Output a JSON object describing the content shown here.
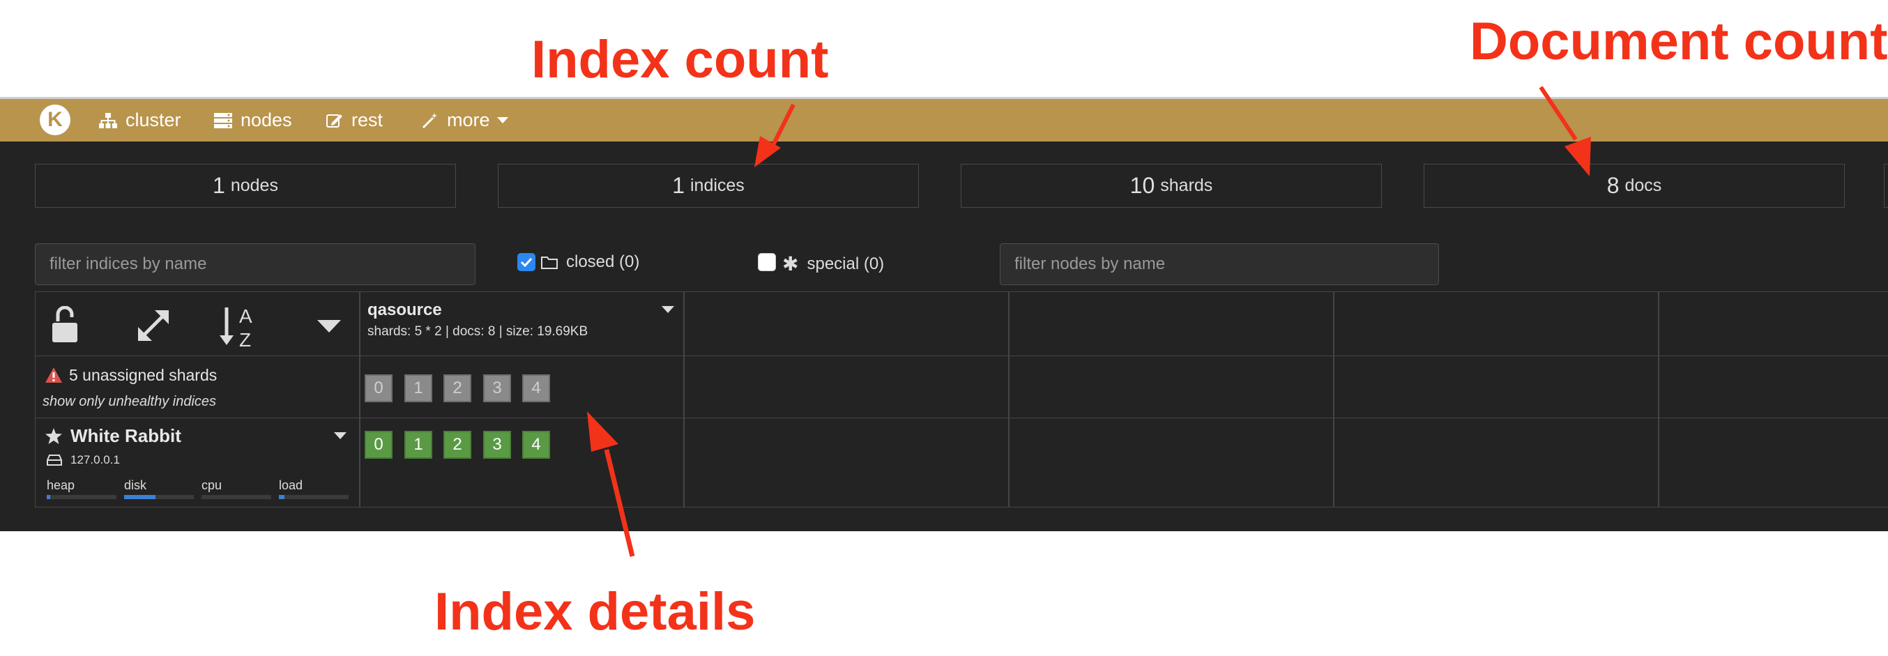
{
  "annotations": {
    "index_count": "Index count",
    "document_count": "Document count",
    "index_details": "Index details"
  },
  "navbar": {
    "logo_letter": "K",
    "items": [
      {
        "label": "cluster",
        "icon": "sitemap-icon"
      },
      {
        "label": "nodes",
        "icon": "server-icon"
      },
      {
        "label": "rest",
        "icon": "edit-icon"
      },
      {
        "label": "more",
        "icon": "magic-wand-icon"
      }
    ]
  },
  "stats": [
    {
      "value": "1",
      "unit": "nodes"
    },
    {
      "value": "1",
      "unit": "indices"
    },
    {
      "value": "10",
      "unit": "shards"
    },
    {
      "value": "8",
      "unit": "docs"
    }
  ],
  "filters": {
    "indices_placeholder": "filter indices by name",
    "closed_label": "closed (0)",
    "closed_checked": true,
    "special_label": "special (0)",
    "special_checked": false,
    "nodes_placeholder": "filter nodes by name"
  },
  "index": {
    "name": "qasource",
    "details": "shards: 5 * 2 | docs: 8 | size: 19.69KB"
  },
  "unassigned": {
    "text": "5 unassigned shards",
    "link": "show only unhealthy indices",
    "shards": [
      "0",
      "1",
      "2",
      "3",
      "4"
    ]
  },
  "node": {
    "name": "White Rabbit",
    "ip": "127.0.0.1",
    "shards": [
      "0",
      "1",
      "2",
      "3",
      "4"
    ],
    "metrics": [
      {
        "label": "heap",
        "value": 0.05
      },
      {
        "label": "disk",
        "value": 0.45
      },
      {
        "label": "cpu",
        "value": 0.0
      },
      {
        "label": "load",
        "value": 0.08
      }
    ]
  },
  "colors": {
    "navbar": "#b9944d",
    "background": "#232323",
    "annotation": "#f3321a",
    "shard_assigned": "#5a9a45",
    "shard_unassigned": "#8a8a8a",
    "checkbox_on": "#2c87f0",
    "meter_fill": "#3b82d6"
  }
}
